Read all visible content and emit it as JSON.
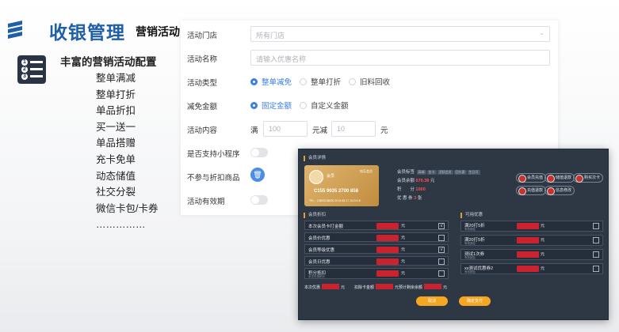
{
  "header": {
    "title": "收银管理",
    "subtitle": "营销活动"
  },
  "menu": {
    "heading": "丰富的营销活动配置",
    "icon_numbers": [
      "1",
      "2",
      "3"
    ],
    "items": [
      "整单满减",
      "整单打折",
      "单品折扣",
      "买一送一",
      "单品搭赠",
      "充卡免单",
      "动态储值",
      "社交分裂",
      "微信卡包/卡券",
      "……………"
    ]
  },
  "form": {
    "store": {
      "label": "活动门店",
      "placeholder": "所有门店"
    },
    "name": {
      "label": "活动名称",
      "placeholder": "请输入优惠名称"
    },
    "type": {
      "label": "活动类型",
      "options": [
        "整单减免",
        "整单打折",
        "旧料回收"
      ],
      "selected": 0
    },
    "amount": {
      "label": "减免金额",
      "options": [
        "固定金额",
        "自定义金额"
      ],
      "selected": 0
    },
    "content": {
      "label": "活动内容",
      "prefix": "满",
      "value1": "100",
      "mid": "元减",
      "value2": "10",
      "suffix": "元"
    },
    "miniapp": {
      "label": "是否支持小程序",
      "enabled": false
    },
    "exclude": {
      "label": "不参与折扣商品"
    },
    "validity": {
      "label": "活动有效期",
      "enabled": false
    }
  },
  "pos": {
    "member_section": "会员详情",
    "card": {
      "name": "会员",
      "level": "钻石会员",
      "number": "C155 9035 2700 858",
      "footer": "TEL：13800138000    2019-08-17 15:24:18"
    },
    "info": [
      {
        "label": "会员标签",
        "value": ""
      },
      {
        "label": "会员余额",
        "value": "670.38",
        "unit": "元"
      },
      {
        "label": "积　　分",
        "value": "1000"
      },
      {
        "label": "优 惠 券",
        "value": "3",
        "unit": "张"
      }
    ],
    "tags": [
      "高端",
      "金卡",
      "活跃会员",
      "回头客",
      "生日月"
    ],
    "buttons": [
      "会员充值",
      "储值退款",
      "购买次卡",
      "充值退款",
      "信息修改"
    ],
    "discount_section": "会员折扣",
    "coupon_section": "可用优惠",
    "discounts": [
      {
        "name": "本次会员卡打金额",
        "checked": true
      },
      {
        "name": "会员价优惠",
        "checked": false
      },
      {
        "name": "会员等级优惠",
        "checked": true
      },
      {
        "name": "会员日优惠",
        "checked": false
      },
      {
        "name": "积分抵扣",
        "sub": "本次可抵积分",
        "checked": false
      }
    ],
    "coupons": [
      {
        "name": "满20打5折",
        "sub": "有效期至",
        "checked": false
      },
      {
        "name": "满20打5折",
        "sub": "有效期至",
        "checked": false
      },
      {
        "name": "测试1次券",
        "sub": "有效期至",
        "checked": false
      },
      {
        "name": "xx测试优惠券2",
        "sub": "有效期至",
        "checked": false
      }
    ],
    "yuan": "元",
    "check": "√",
    "totals": [
      {
        "label": "本次优惠"
      },
      {
        "label": "扣除卡金额"
      },
      {
        "label": "预计剩余余额"
      }
    ],
    "cancel": "取消",
    "confirm": "确定支付"
  },
  "colors": {
    "brand": "#1f5fa8",
    "accent": "#3b7fe6",
    "pos_bg": "#2e3845",
    "highlight": "#c8232f",
    "button": "#f5a623"
  }
}
